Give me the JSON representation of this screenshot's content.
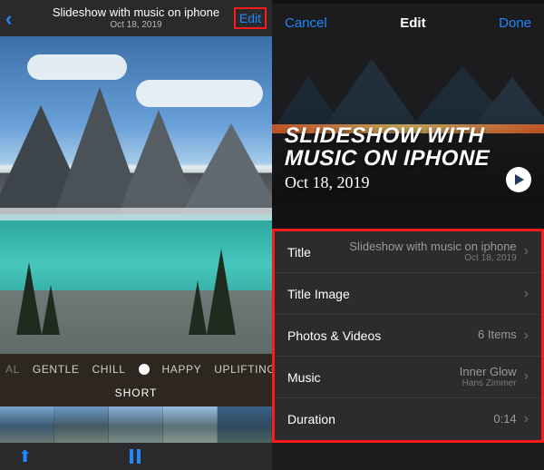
{
  "left": {
    "title": "Slideshow with music on iphone",
    "subtitle": "Oct 18, 2019",
    "edit_label": "Edit",
    "moods": [
      "AL",
      "GENTLE",
      "CHILL",
      "HAPPY",
      "UPLIFTING"
    ],
    "length_label": "SHORT"
  },
  "right": {
    "header": {
      "cancel": "Cancel",
      "title": "Edit",
      "done": "Done"
    },
    "banner": {
      "title_line1": "SLIDESHOW WITH",
      "title_line2": "MUSIC ON IPHONE",
      "date": "Oct 18, 2019"
    },
    "rows": {
      "title": {
        "label": "Title",
        "value": "Slideshow with music on iphone",
        "sub": "Oct 18, 2019"
      },
      "title_image": {
        "label": "Title Image",
        "value": ""
      },
      "media": {
        "label": "Photos & Videos",
        "value": "6 Items"
      },
      "music": {
        "label": "Music",
        "value": "Inner Glow",
        "sub": "Hans Zimmer"
      },
      "duration": {
        "label": "Duration",
        "value": "0:14"
      }
    }
  }
}
